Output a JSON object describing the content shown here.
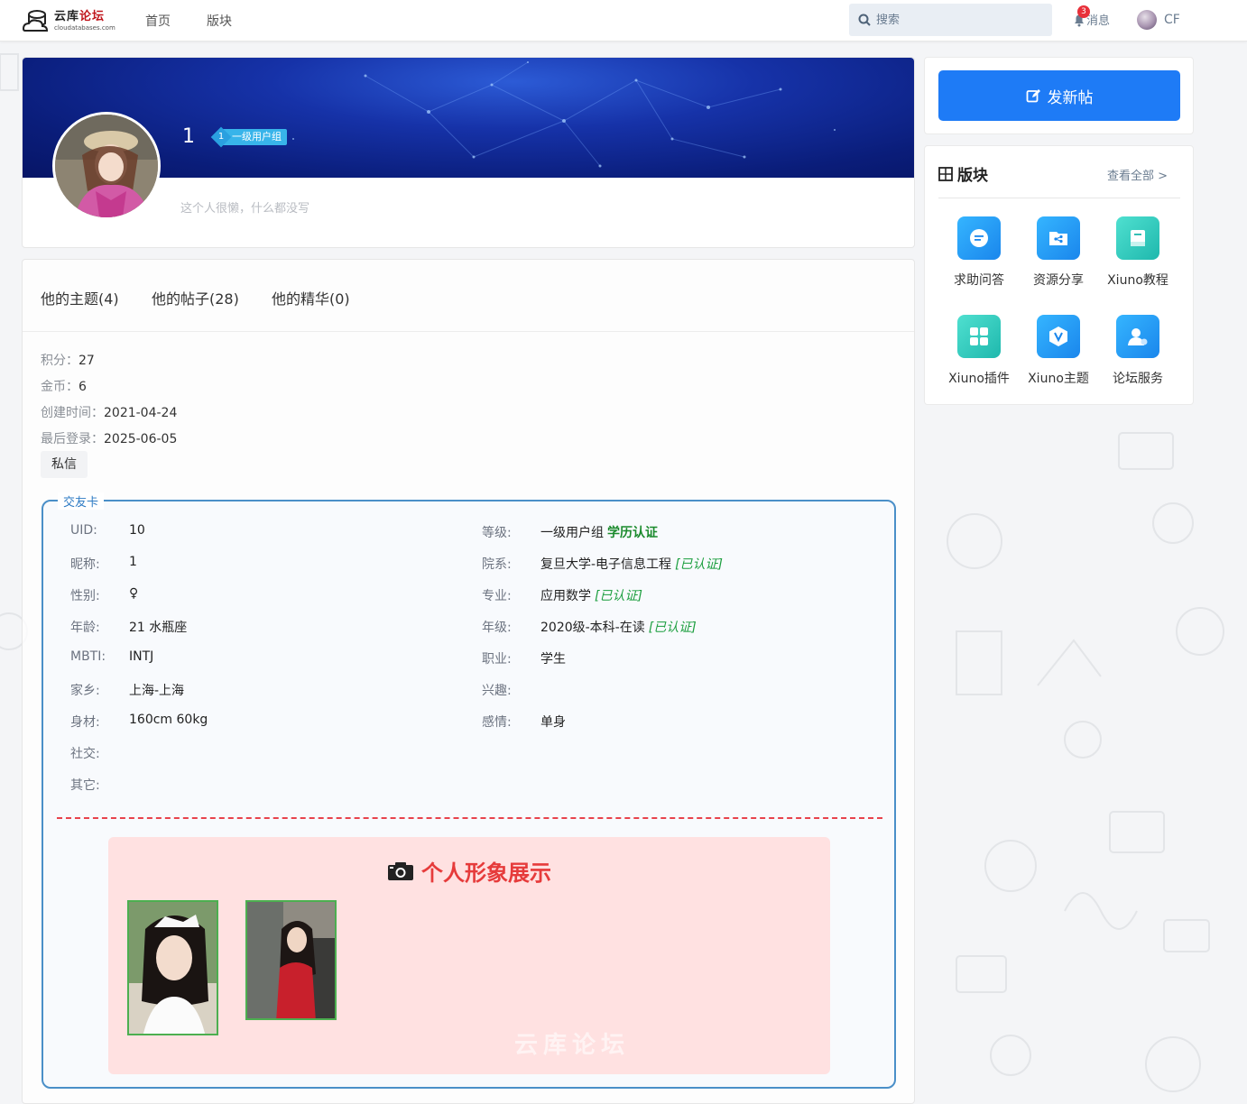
{
  "nav": {
    "logo_title_a": "云库",
    "logo_title_b": "论坛",
    "logo_sub": "cloudatabases.com",
    "home": "首页",
    "sections": "版块",
    "search_placeholder": "搜索",
    "message_label": "消息",
    "message_count": "3",
    "user_initials": "CF"
  },
  "profile": {
    "username": "1",
    "level_num": "1",
    "group": "一级用户组",
    "bio": "这个人很懒，什么都没写"
  },
  "tabs": [
    "他的主题(4)",
    "他的帖子(28)",
    "他的精华(0)"
  ],
  "stats": [
    {
      "k": "积分：",
      "v": "27"
    },
    {
      "k": "金币：",
      "v": "6"
    },
    {
      "k": "创建时间：",
      "v": "2021-04-24"
    },
    {
      "k": "最后登录：",
      "v": "2025-06-05"
    }
  ],
  "pm_button": "私信",
  "friend_card": {
    "legend": "交友卡",
    "left": [
      {
        "k": "UID:",
        "v": "10"
      },
      {
        "k": "昵称:",
        "v": "1"
      },
      {
        "k": "性别:",
        "v": "♀"
      },
      {
        "k": "年龄:",
        "v": "21 水瓶座"
      },
      {
        "k": "MBTI:",
        "v": "INTJ"
      },
      {
        "k": "家乡:",
        "v": "上海-上海"
      },
      {
        "k": "身材:",
        "v": "160cm 60kg"
      },
      {
        "k": "社交:",
        "v": ""
      },
      {
        "k": "其它:",
        "v": ""
      }
    ],
    "right": [
      {
        "k": "等级:",
        "v": "一级用户组",
        "extra": "学历认证",
        "extra_style": "bold"
      },
      {
        "k": "院系:",
        "v": "复旦大学-电子信息工程",
        "extra": "[已认证]",
        "extra_style": "verified"
      },
      {
        "k": "专业:",
        "v": "应用数学",
        "extra": "[已认证]",
        "extra_style": "verified"
      },
      {
        "k": "年级:",
        "v": "2020级-本科-在读",
        "extra": "[已认证]",
        "extra_style": "verified"
      },
      {
        "k": "职业:",
        "v": "学生",
        "extra": "",
        "extra_style": ""
      },
      {
        "k": "兴趣:",
        "v": "",
        "extra": "",
        "extra_style": ""
      },
      {
        "k": "感情:",
        "v": "单身",
        "extra": "",
        "extra_style": ""
      }
    ],
    "showcase_title": "个人形象展示",
    "watermark": "云库论坛"
  },
  "sidebar": {
    "post_button": "发新帖",
    "forums_title": "版块",
    "view_all": "查看全部 >",
    "forums": [
      {
        "label": "求助问答",
        "icon": "chat-doc-icon",
        "color": "#1a93f0"
      },
      {
        "label": "资源分享",
        "icon": "share-folder-icon",
        "color": "#1a93f0"
      },
      {
        "label": "Xiuno教程",
        "icon": "book-icon",
        "color": "#2ec4b6"
      },
      {
        "label": "Xiuno插件",
        "icon": "grid-apps-icon",
        "color": "#2ec4b6"
      },
      {
        "label": "Xiuno主题",
        "icon": "hexagon-v-icon",
        "color": "#1a93f0"
      },
      {
        "label": "论坛服务",
        "icon": "user-service-icon",
        "color": "#1a93f0"
      }
    ]
  },
  "colors": {
    "accent": "#1e7bf6",
    "banner": "#0a1d7a",
    "verified": "#1b9e3e",
    "showcase_bg": "#ffe1e1",
    "showcase_title": "#e63b3b"
  }
}
